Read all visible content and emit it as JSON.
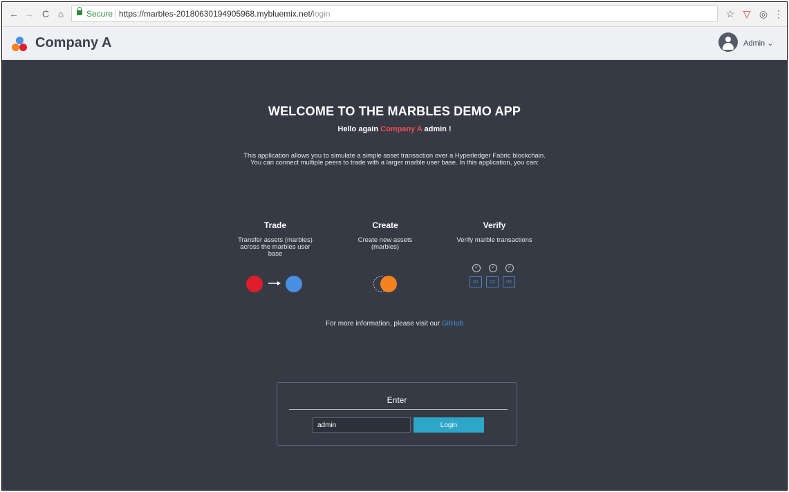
{
  "browser": {
    "back": "←",
    "forward": "→",
    "reload": "C",
    "home": "⌂",
    "secure_label": "Secure",
    "url_base": "https://marbles-20180630194905968.mybluemix.net/",
    "url_path": "login",
    "star": "☆",
    "ext_shield": "▽",
    "ext_gear": "◎",
    "menu": "⋮"
  },
  "header": {
    "company": "Company A",
    "user_menu": "Admin ⌄"
  },
  "main": {
    "title": "WELCOME TO THE MARBLES DEMO APP",
    "greeting_prefix": "Hello again ",
    "greeting_company": "Company A",
    "greeting_suffix": " admin !",
    "description_line1": "This application allows you to simulate a simple asset transaction over a Hyperledger Fabric blockchain.",
    "description_line2": "You can connect multiple peers to trade with a larger marble user base. In this application, you can:",
    "features": [
      {
        "title": "Trade",
        "text": "Transfer assets (marbles) across the marbles user base"
      },
      {
        "title": "Create",
        "text": "Create new assets (marbles)"
      },
      {
        "title": "Verify",
        "text": "Verify marble transactions"
      }
    ],
    "verify_boxes": [
      "01",
      "02",
      "03"
    ],
    "more_info": "For more information, please visit our ",
    "github_link": "GitHub"
  },
  "login": {
    "heading": "Enter",
    "username_value": "admin",
    "button_label": "Login"
  },
  "colors": {
    "background": "#353a45",
    "red_marble": "#e01e2b",
    "blue_marble": "#4a90e2",
    "orange_marble": "#f5821f",
    "accent": "#2ea6c8"
  }
}
